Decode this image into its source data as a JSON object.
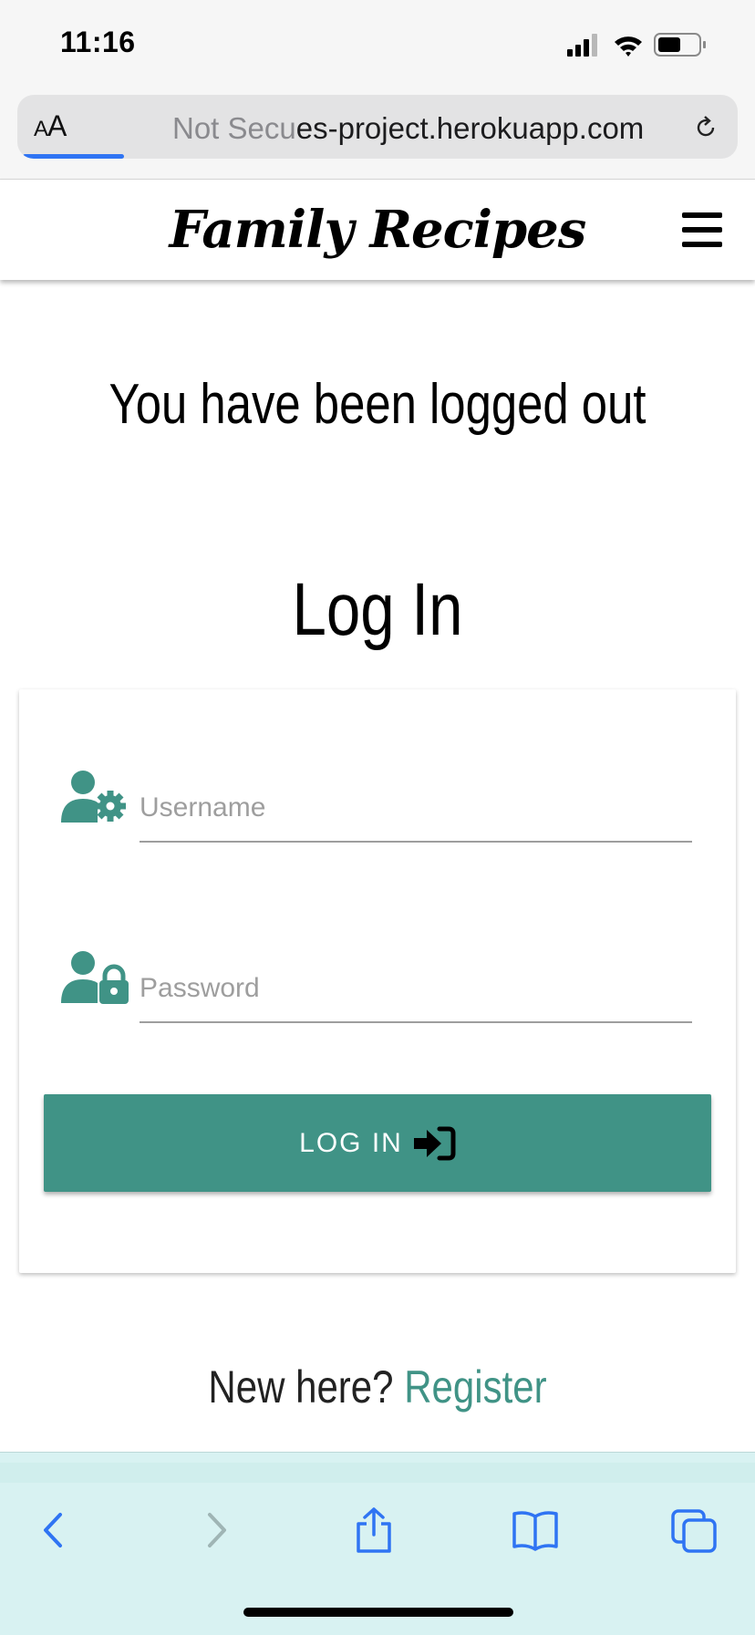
{
  "status_bar": {
    "time": "11:16"
  },
  "browser": {
    "text_size_button": "AA",
    "url_prefix": "Not Secu",
    "url_domain": "es-project.herokuapp.com",
    "load_progress": 0.14
  },
  "nav": {
    "brand": "Family Recipes"
  },
  "main": {
    "flash_message": "You have been logged out",
    "page_title": "Log In",
    "username_placeholder": "Username",
    "password_placeholder": "Password",
    "login_button_label": "LOG IN",
    "register_prompt": "New here?",
    "register_link": "Register"
  },
  "colors": {
    "accent": "#409386",
    "status_progress": "#2f74f3",
    "toolbar_icon": "#2f74f3"
  },
  "icons": {
    "username": "user-gear-icon",
    "password": "user-lock-icon",
    "login": "sign-in-icon",
    "menu": "hamburger-menu-icon"
  }
}
